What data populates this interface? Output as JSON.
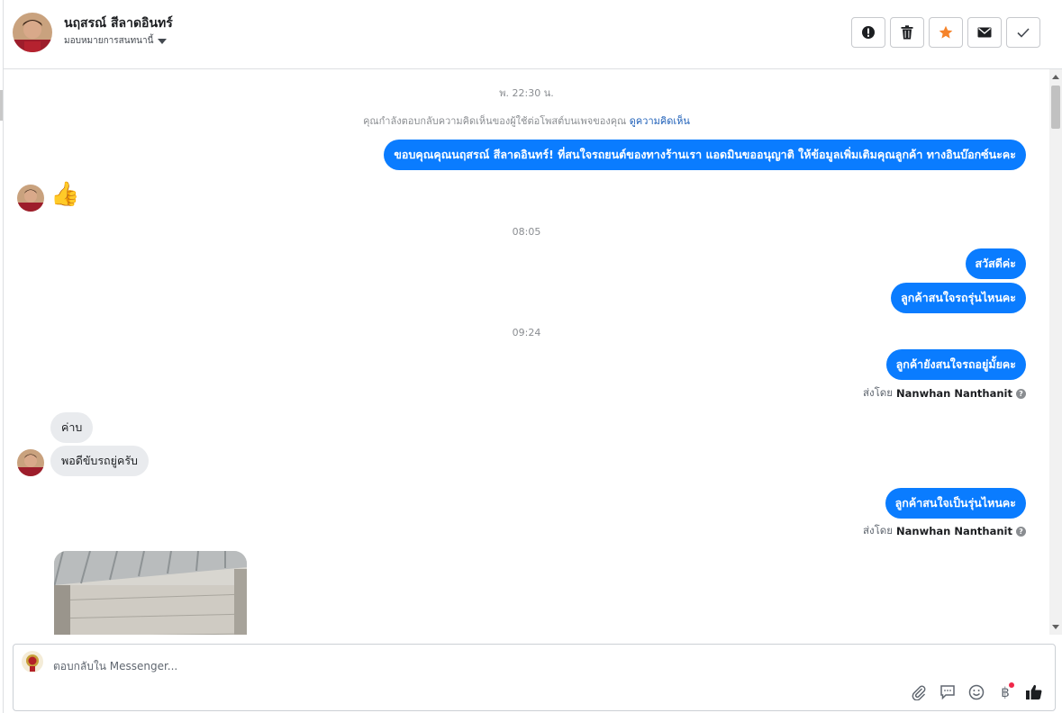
{
  "header": {
    "contact_name": "นฤสรณ์ สีลาดอินทร์",
    "assign_label": "มอบหมายการสนทนานี้",
    "actions": [
      {
        "name": "spam-button",
        "icon": "exclamation-icon"
      },
      {
        "name": "delete-button",
        "icon": "trash-icon"
      },
      {
        "name": "star-button",
        "icon": "star-icon"
      },
      {
        "name": "mark-unread-button",
        "icon": "envelope-icon"
      },
      {
        "name": "mark-done-button",
        "icon": "check-icon"
      }
    ]
  },
  "conversation": {
    "timestamp_1": "พ. 22:30 น.",
    "notice_text": "คุณกำลังตอบกลับความคิดเห็นของผู้ใช้ต่อโพสต์บนเพจของคุณ",
    "notice_link": "ดูความคิดเห็น",
    "msg_1": "ขอบคุณคุณนฤสรณ์ สีลาดอินทร์! ที่สนใจรถยนต์ของทางร้านเรา แอดมินขออนุญาติ ให้ข้อมูลเพิ่มเติมคุณลูกค้า ทางอินบ๊อกซ์นะคะ",
    "reaction_emoji": "👍",
    "timestamp_2": "08:05",
    "msg_2": "สวัสดีค่ะ",
    "msg_3": "ลูกค้าสนใจรถรุ่นไหนคะ",
    "timestamp_3": "09:24",
    "msg_4": "ลูกค้ายังสนใจรถอยู่มั้ยคะ",
    "sent_by_prefix_1": "ส่งโดย",
    "sent_by_name_1": "Nanwhan Nanthanit",
    "in_1": "ค่าบ",
    "in_2": "พอดีขับรถยู่ครับ",
    "msg_5": "ลูกค้าสนใจเป็นรุ่นไหนคะ",
    "sent_by_prefix_2": "ส่งโดย",
    "sent_by_name_2": "Nanwhan Nanthanit"
  },
  "composer": {
    "placeholder": "ตอบกลับใน Messenger...",
    "currency_symbol": "฿",
    "tools": [
      "attach-icon",
      "saved-reply-icon",
      "emoji-icon",
      "payment-icon",
      "like-icon"
    ]
  },
  "colors": {
    "outgoing_bubble": "#0a7cff",
    "incoming_bubble": "#e9ebee",
    "star": "#f5832a",
    "link": "#1d5fb8"
  }
}
